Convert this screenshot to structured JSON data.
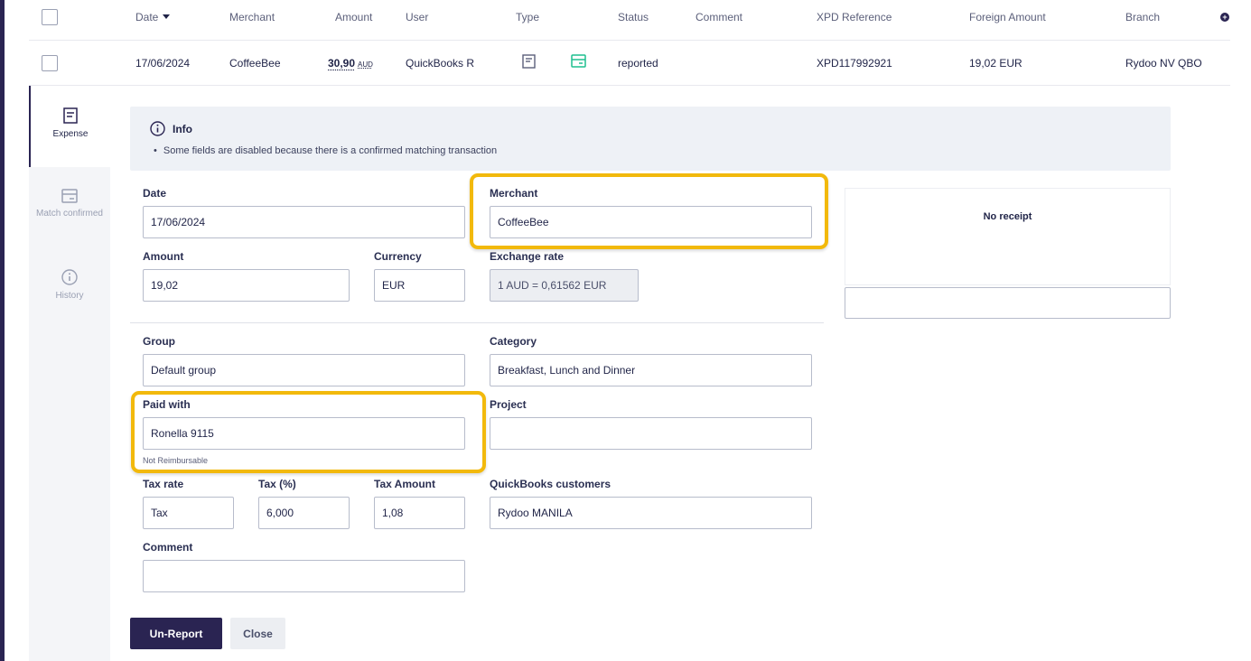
{
  "table": {
    "columns": {
      "date": "Date",
      "merchant": "Merchant",
      "amount": "Amount",
      "user": "User",
      "type": "Type",
      "status": "Status",
      "comment": "Comment",
      "xpd_reference": "XPD Reference",
      "foreign_amount": "Foreign Amount",
      "branch": "Branch"
    },
    "row": {
      "date": "17/06/2024",
      "merchant": "CoffeeBee",
      "amount_value": "30,90",
      "amount_currency": "AUD",
      "user": "QuickBooks R",
      "type_icons": [
        "receipt-icon",
        "card-icon"
      ],
      "status": "reported",
      "comment": "",
      "xpd_reference": "XPD117992921",
      "foreign_amount": "19,02 EUR",
      "branch": "Rydoo NV QBO"
    }
  },
  "sidebar": {
    "tabs": [
      {
        "label": "Expense",
        "icon": "receipt-icon",
        "active": true
      },
      {
        "label": "Match confirmed",
        "icon": "card-icon",
        "active": false
      },
      {
        "label": "History",
        "icon": "info-icon",
        "active": false
      }
    ]
  },
  "info": {
    "title": "Info",
    "message": "Some fields are disabled because there is a confirmed matching transaction"
  },
  "form": {
    "date": {
      "label": "Date",
      "value": "17/06/2024"
    },
    "merchant": {
      "label": "Merchant",
      "value": "CoffeeBee"
    },
    "amount": {
      "label": "Amount",
      "value": "19,02"
    },
    "currency": {
      "label": "Currency",
      "value": "EUR"
    },
    "exchange_rate": {
      "label": "Exchange rate",
      "value": "1 AUD = 0,61562 EUR"
    },
    "group": {
      "label": "Group",
      "value": "Default group"
    },
    "category": {
      "label": "Category",
      "value": "Breakfast, Lunch and Dinner"
    },
    "paid_with": {
      "label": "Paid with",
      "value": "Ronella 9115",
      "hint": "Not Reimbursable"
    },
    "project": {
      "label": "Project",
      "value": ""
    },
    "tax_rate": {
      "label": "Tax rate",
      "value": "Tax"
    },
    "tax_percent": {
      "label": "Tax (%)",
      "value": "6,000"
    },
    "tax_amount": {
      "label": "Tax Amount",
      "value": "1,08"
    },
    "quickbooks_customers": {
      "label": "QuickBooks customers",
      "value": "Rydoo MANILA"
    },
    "comment": {
      "label": "Comment",
      "value": ""
    }
  },
  "receipt": {
    "text": "No receipt"
  },
  "actions": {
    "unreport": "Un-Report",
    "close": "Close"
  },
  "colors": {
    "brand": "#2a2452",
    "highlight": "#f2b90c",
    "accent_green": "#1fbf8f"
  }
}
